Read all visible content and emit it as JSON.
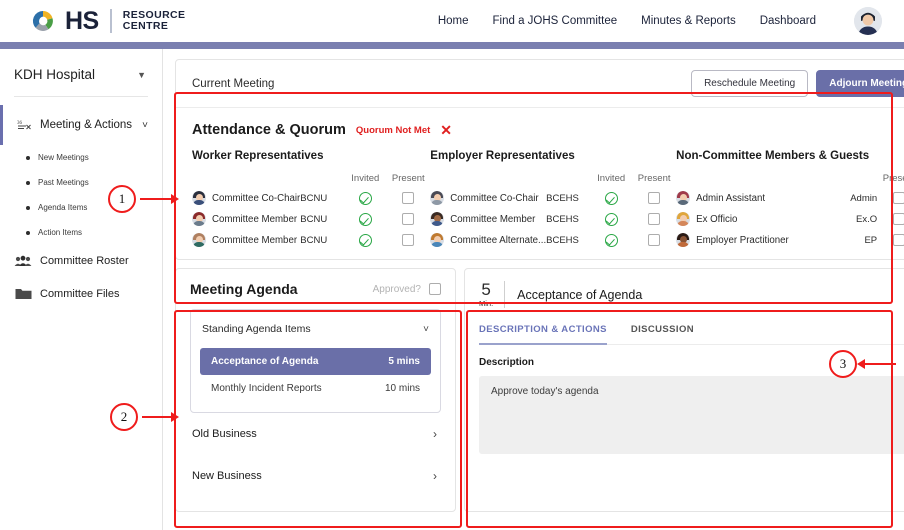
{
  "header": {
    "logo_primary": "HS",
    "logo_sub_line1": "RESOURCE",
    "logo_sub_line2": "CENTRE",
    "nav": [
      {
        "label": "Home"
      },
      {
        "label": "Find a JOHS Committee"
      },
      {
        "label": "Minutes & Reports"
      },
      {
        "label": "Dashboard"
      }
    ],
    "avatar_icon": "user-avatar"
  },
  "sidebar": {
    "org_name": "KDH Hospital",
    "org_caret_icon": "caret-down-icon",
    "section": {
      "label": "Meeting & Actions",
      "icon": "meeting-icon",
      "chevron_icon": "chevron-down-icon"
    },
    "sub_items": [
      {
        "label": "New Meetings"
      },
      {
        "label": "Past Meetings"
      },
      {
        "label": "Agenda Items"
      },
      {
        "label": "Action Items"
      }
    ],
    "nav_rows": [
      {
        "label": "Committee Roster",
        "icon": "people-icon"
      },
      {
        "label": "Committee Files",
        "icon": "folder-icon"
      }
    ]
  },
  "meeting_bar": {
    "title": "Current Meeting",
    "reschedule_label": "Reschedule Meeting",
    "adjourn_label": "Adjourn Meeting"
  },
  "attendance": {
    "title": "Attendance & Quorum",
    "quorum_status": "Quorum Not Met",
    "quorum_icon": "x-icon",
    "collapse_icon": "chevron-up-icon",
    "columns": {
      "invited": "Invited",
      "present": "Present"
    },
    "worker": {
      "title": "Worker Representatives",
      "rows": [
        {
          "name": "Committee Co-Chair",
          "org": "BCNU",
          "invited": true,
          "present": false
        },
        {
          "name": "Committee Member",
          "org": "BCNU",
          "invited": true,
          "present": false
        },
        {
          "name": "Committee Member",
          "org": "BCNU",
          "invited": true,
          "present": false
        }
      ]
    },
    "employer": {
      "title": "Employer Representatives",
      "rows": [
        {
          "name": "Committee Co-Chair",
          "org": "BCEHS",
          "invited": true,
          "present": false
        },
        {
          "name": "Committee Member",
          "org": "BCEHS",
          "invited": true,
          "present": false
        },
        {
          "name": "Committee Alternate...",
          "org": "BCEHS",
          "invited": true,
          "present": false
        }
      ]
    },
    "guests": {
      "title": "Non-Committee Members & Guests",
      "rows": [
        {
          "name": "Admin Assistant",
          "org": "Admin",
          "present": false
        },
        {
          "name": "Ex Officio",
          "org": "Ex.O",
          "present": false
        },
        {
          "name": "Employer Practitioner",
          "org": "EP",
          "present": false
        }
      ]
    }
  },
  "agenda": {
    "title": "Meeting Agenda",
    "approved_label": "Approved?",
    "approved_checked": false,
    "group": {
      "label": "Standing Agenda Items",
      "chevron_icon": "chevron-down-icon",
      "items": [
        {
          "label": "Acceptance of Agenda",
          "duration": "5 mins",
          "active": true
        },
        {
          "label": "Monthly Incident Reports",
          "duration": "10 mins",
          "active": false
        }
      ]
    },
    "collapsed_groups": [
      {
        "label": "Old Business",
        "arrow_icon": "chevron-right-icon"
      },
      {
        "label": "New Business",
        "arrow_icon": "chevron-right-icon"
      }
    ]
  },
  "detail": {
    "minutes_value": "5",
    "minutes_unit": "Min.",
    "title": "Acceptance of Agenda",
    "tabs": [
      {
        "label": "DESCRIPTION & ACTIONS",
        "active": true
      },
      {
        "label": "DISCUSSION",
        "active": false
      }
    ],
    "description_label": "Description",
    "description_text": "Approve today's agenda"
  },
  "annotations": [
    {
      "number": "1"
    },
    {
      "number": "2"
    },
    {
      "number": "3"
    }
  ],
  "colors": {
    "accent_purple": "#6a6fa8",
    "header_bar": "#7a7fb0",
    "danger_red": "#e02020",
    "success_green": "#29a745",
    "annotation_red": "#ef1c1c",
    "tab_active": "#6a74b8"
  }
}
